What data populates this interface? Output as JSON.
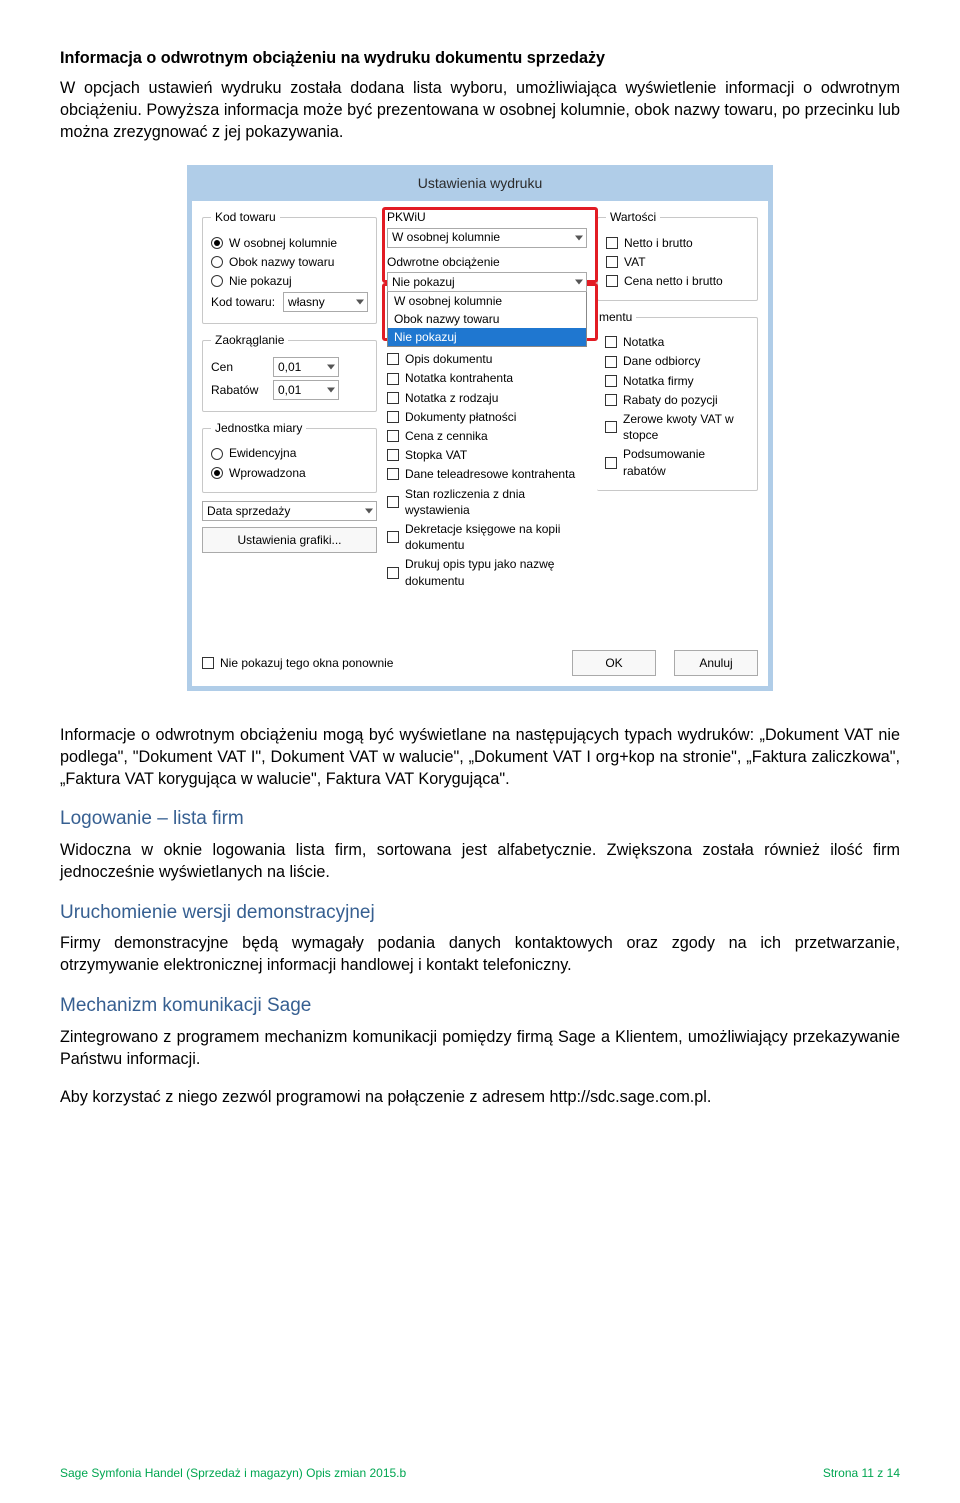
{
  "title": "Informacja o odwrotnym obciążeniu na wydruku dokumentu sprzedaży",
  "p1": "W opcjach ustawień wydruku została dodana lista wyboru, umożliwiająca wyświetlenie informacji o odwrotnym obciążeniu. Powyższa informacja może być prezentowana w osobnej kolumnie, obok nazwy towaru, po przecinku lub można zrezygnować z jej pokazywania.",
  "dialog": {
    "title": "Ustawienia wydruku",
    "col1": {
      "fs1_legend": "Kod towaru",
      "r1": "W osobnej kolumnie",
      "r2": "Obok nazwy towaru",
      "r3": "Nie pokazuj",
      "lbl_kod": "Kod towaru:",
      "sel_kod": "własny",
      "fs2_legend": "Zaokrąglanie",
      "lbl_cen": "Cen",
      "sel_cen": "0,01",
      "lbl_rab": "Rabatów",
      "sel_rab": "0,01",
      "fs3_legend": "Jednostka miary",
      "r4": "Ewidencyjna",
      "r5": "Wprowadzona",
      "sel_date": "Data sprzedaży",
      "btn_graf": "Ustawienia grafiki..."
    },
    "col2": {
      "lbl_pkwiu": "PKWiU",
      "sel_pkwiu": "W osobnej kolumnie",
      "lbl_oo": "Odwrotne obciążenie",
      "sel_oo": "Nie pokazuj",
      "opt1": "W osobnej kolumnie",
      "opt2": "Obok nazwy towaru",
      "opt3": "Nie pokazuj",
      "c1": "Opis dokumentu",
      "c2": "Notatka kontrahenta",
      "c3": "Notatka z rodzaju",
      "c4": "Dokumenty płatności",
      "c5": "Cena z cennika",
      "c6": "Stopka VAT",
      "c7": "Dane teleadresowe kontrahenta",
      "c8": "Stan rozliczenia z dnia wystawienia",
      "c9": "Dekretacje księgowe na kopii dokumentu",
      "c10": "Drukuj opis typu jako nazwę dokumentu"
    },
    "col3": {
      "lbl_w": "Wartości",
      "w1": "Netto i brutto",
      "w2": "VAT",
      "w3": "Cena netto i brutto",
      "suffix": "mentu",
      "d1": "Notatka",
      "d2": "Dane odbiorcy",
      "d3": "Notatka firmy",
      "d4": "Rabaty do pozycji",
      "d5": "Zerowe kwoty VAT w stopce",
      "d6": "Podsumowanie rabatów"
    },
    "footer": {
      "chk": "Nie pokazuj tego okna ponownie",
      "ok": "OK",
      "cancel": "Anuluj"
    }
  },
  "p2": "Informacje o odwrotnym obciążeniu mogą być wyświetlane na następujących typach wydruków: „Dokument VAT nie podlega\", \"Dokument VAT I\", Dokument VAT w walucie\", „Dokument VAT I org+kop na stronie\", „Faktura zaliczkowa\", „Faktura VAT korygująca w walucie\", Faktura VAT Korygująca\".",
  "h2a": "Logowanie – lista firm",
  "p3": "Widoczna w oknie logowania lista firm, sortowana jest alfabetycznie. Zwiększona została również ilość firm jednocześnie wyświetlanych na liście.",
  "h2b": "Uruchomienie wersji demonstracyjnej",
  "p4": "Firmy demonstracyjne będą wymagały podania danych kontaktowych oraz zgody na ich przetwarzanie, otrzymywanie elektronicznej informacji handlowej i kontakt telefoniczny.",
  "h2c": "Mechanizm komunikacji Sage",
  "p5": "Zintegrowano z programem mechanizm komunikacji pomiędzy firmą Sage a Klientem, umożliwiający przekazywanie Państwu informacji.",
  "p6": "Aby korzystać z niego zezwól programowi na połączenie z adresem http://sdc.sage.com.pl.",
  "footer": {
    "left": "Sage Symfonia Handel (Sprzedaż i magazyn) Opis zmian 2015.b",
    "right": "Strona 11 z 14"
  }
}
